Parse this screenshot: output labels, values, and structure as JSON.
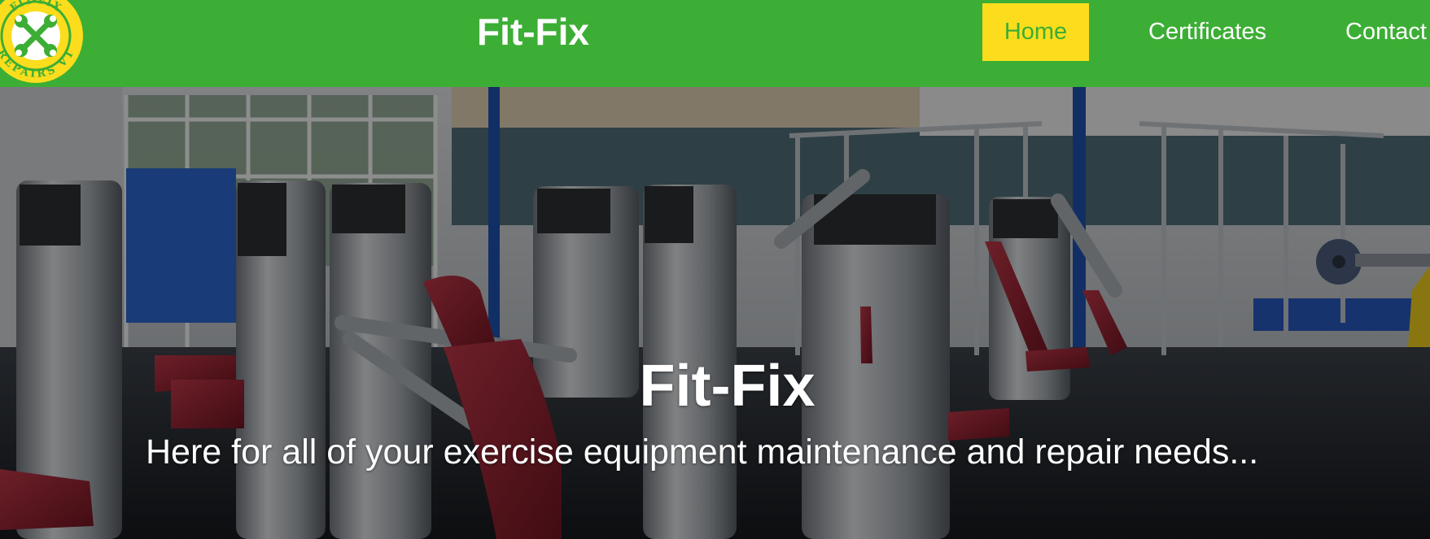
{
  "brand": {
    "logo_text_top": "FIT-FIX",
    "logo_text_bottom": "REPAIRS VT",
    "logo_icon": "crossed-wrenches-icon",
    "name": "Fit-Fix"
  },
  "nav": {
    "items": [
      {
        "label": "Home",
        "active": true
      },
      {
        "label": "Certificates",
        "active": false
      },
      {
        "label": "Contact",
        "active": false
      }
    ]
  },
  "hero": {
    "image": "gym-weight-machines-photo",
    "title": "Fit-Fix",
    "subtitle": "Here for all of your exercise equipment maintenance and repair needs..."
  },
  "colors": {
    "header_green": "#3cae35",
    "active_yellow": "#fbdd1d",
    "white": "#ffffff"
  }
}
